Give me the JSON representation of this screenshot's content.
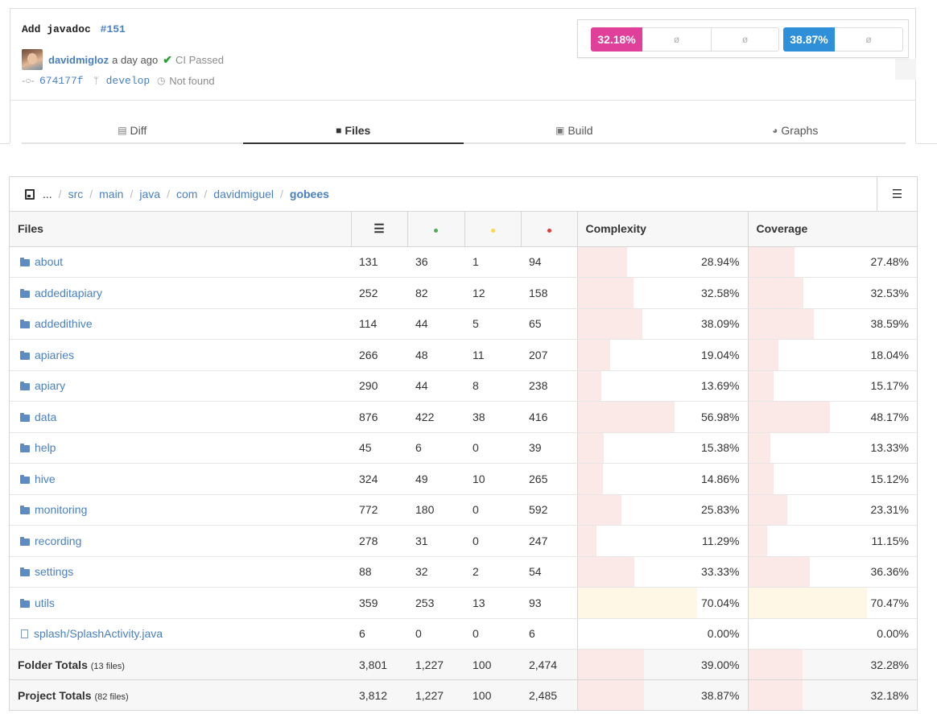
{
  "commit": {
    "title": "Add javadoc",
    "pr": "#151",
    "author": "davidmigloz",
    "time": "a day ago",
    "ci_status": "CI Passed",
    "sha": "674177f",
    "branch": "develop",
    "compare": "Not found"
  },
  "stats": {
    "pink_value": "32.18%",
    "blue_value": "38.87%",
    "empty": "ø",
    "colors": {
      "pink": "#e0409a",
      "blue": "#2f8fd8"
    }
  },
  "tabs": [
    {
      "label": "Diff",
      "icon": "diff-icon"
    },
    {
      "label": "Files",
      "icon": "folder-icon",
      "active": true
    },
    {
      "label": "Build",
      "icon": "box-icon"
    },
    {
      "label": "Graphs",
      "icon": "pie-chart-icon"
    }
  ],
  "breadcrumb": [
    "...",
    "src",
    "main",
    "java",
    "com",
    "davidmiguel",
    "gobees"
  ],
  "table": {
    "headers": {
      "files": "Files",
      "complexity": "Complexity",
      "coverage": "Coverage"
    },
    "dot_colors": {
      "hit": "#4caf50",
      "partial": "#ffd54f",
      "miss": "#e53935"
    },
    "rows": [
      {
        "name": "about",
        "type": "folder",
        "lines": "131",
        "hits": "36",
        "partials": "1",
        "misses": "94",
        "complexity": "28.94%",
        "coverage": "27.48%",
        "complexity_frac": 0.2894,
        "coverage_frac": 0.2748
      },
      {
        "name": "addeditapiary",
        "type": "folder",
        "lines": "252",
        "hits": "82",
        "partials": "12",
        "misses": "158",
        "complexity": "32.58%",
        "coverage": "32.53%",
        "complexity_frac": 0.3258,
        "coverage_frac": 0.3253
      },
      {
        "name": "addedithive",
        "type": "folder",
        "lines": "114",
        "hits": "44",
        "partials": "5",
        "misses": "65",
        "complexity": "38.09%",
        "coverage": "38.59%",
        "complexity_frac": 0.3809,
        "coverage_frac": 0.3859
      },
      {
        "name": "apiaries",
        "type": "folder",
        "lines": "266",
        "hits": "48",
        "partials": "11",
        "misses": "207",
        "complexity": "19.04%",
        "coverage": "18.04%",
        "complexity_frac": 0.1904,
        "coverage_frac": 0.1804
      },
      {
        "name": "apiary",
        "type": "folder",
        "lines": "290",
        "hits": "44",
        "partials": "8",
        "misses": "238",
        "complexity": "13.69%",
        "coverage": "15.17%",
        "complexity_frac": 0.1369,
        "coverage_frac": 0.1517
      },
      {
        "name": "data",
        "type": "folder",
        "lines": "876",
        "hits": "422",
        "partials": "38",
        "misses": "416",
        "complexity": "56.98%",
        "coverage": "48.17%",
        "complexity_frac": 0.5698,
        "coverage_frac": 0.4817
      },
      {
        "name": "help",
        "type": "folder",
        "lines": "45",
        "hits": "6",
        "partials": "0",
        "misses": "39",
        "complexity": "15.38%",
        "coverage": "13.33%",
        "complexity_frac": 0.1538,
        "coverage_frac": 0.1333
      },
      {
        "name": "hive",
        "type": "folder",
        "lines": "324",
        "hits": "49",
        "partials": "10",
        "misses": "265",
        "complexity": "14.86%",
        "coverage": "15.12%",
        "complexity_frac": 0.1486,
        "coverage_frac": 0.1512
      },
      {
        "name": "monitoring",
        "type": "folder",
        "lines": "772",
        "hits": "180",
        "partials": "0",
        "misses": "592",
        "complexity": "25.83%",
        "coverage": "23.31%",
        "complexity_frac": 0.2583,
        "coverage_frac": 0.2331
      },
      {
        "name": "recording",
        "type": "folder",
        "lines": "278",
        "hits": "31",
        "partials": "0",
        "misses": "247",
        "complexity": "11.29%",
        "coverage": "11.15%",
        "complexity_frac": 0.1129,
        "coverage_frac": 0.1115
      },
      {
        "name": "settings",
        "type": "folder",
        "lines": "88",
        "hits": "32",
        "partials": "2",
        "misses": "54",
        "complexity": "33.33%",
        "coverage": "36.36%",
        "complexity_frac": 0.3333,
        "coverage_frac": 0.3636
      },
      {
        "name": "utils",
        "type": "folder",
        "lines": "359",
        "hits": "253",
        "partials": "13",
        "misses": "93",
        "complexity": "70.04%",
        "coverage": "70.47%",
        "complexity_frac": 0.7004,
        "coverage_frac": 0.7047,
        "warn": true
      },
      {
        "name": "splash/SplashActivity.java",
        "type": "file",
        "lines": "6",
        "hits": "0",
        "partials": "0",
        "misses": "6",
        "complexity": "0.00%",
        "coverage": "0.00%",
        "complexity_frac": 0,
        "coverage_frac": 0
      }
    ],
    "totals": [
      {
        "label": "Folder Totals",
        "sub": "(13 files)",
        "lines": "3,801",
        "hits": "1,227",
        "partials": "100",
        "misses": "2,474",
        "complexity": "39.00%",
        "coverage": "32.28%",
        "complexity_frac": 0.39,
        "coverage_frac": 0.3228
      },
      {
        "label": "Project Totals",
        "sub": "(82 files)",
        "lines": "3,812",
        "hits": "1,227",
        "partials": "100",
        "misses": "2,485",
        "complexity": "38.87%",
        "coverage": "32.18%",
        "complexity_frac": 0.3887,
        "coverage_frac": 0.3218
      }
    ]
  }
}
